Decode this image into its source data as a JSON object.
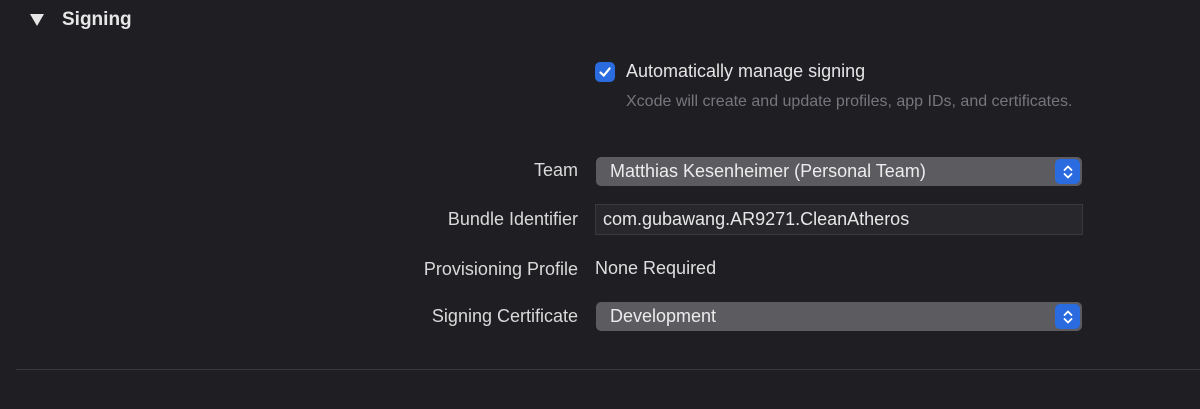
{
  "section": {
    "title": "Signing"
  },
  "auto_signing": {
    "label": "Automatically manage signing",
    "checked": true,
    "help": "Xcode will create and update profiles, app IDs, and certificates."
  },
  "team": {
    "label": "Team",
    "value": "Matthias Kesenheimer (Personal Team)"
  },
  "bundle_identifier": {
    "label": "Bundle Identifier",
    "value": "com.gubawang.AR9271.CleanAtheros"
  },
  "provisioning_profile": {
    "label": "Provisioning Profile",
    "value": "None Required"
  },
  "signing_certificate": {
    "label": "Signing Certificate",
    "value": "Development"
  },
  "colors": {
    "background": "#1f1e22",
    "accent": "#2a6ce0",
    "popup": "#5c5b60",
    "secondary_text": "#77767c"
  },
  "icons": {
    "disclosure": "disclosure-triangle-down-icon",
    "checkbox": "checkmark-icon",
    "popup": "up-down-chevron-icon"
  }
}
